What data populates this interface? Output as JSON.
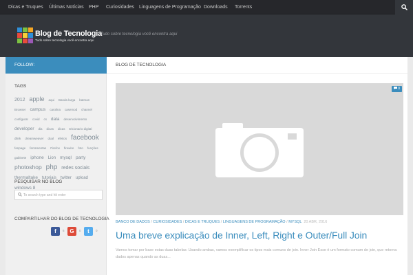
{
  "topnav": {
    "items": [
      "Dicas e Truques",
      "Últimas Notícias",
      "PHP",
      "Curiosidades",
      "Linguagens de Programação",
      "Downloads",
      "Torrents"
    ],
    "search_icon": "search-icon"
  },
  "header": {
    "brand_title": "Blog de Tecnologia",
    "brand_subtitle": "Tudo sobre tecnologia você encontra aqui",
    "tagline": "Tudo sobre tecnologia você encontra aqui"
  },
  "sidebar": {
    "follow_label": "FOLLOW:",
    "tags_title": "TAGS",
    "tags": [
      {
        "t": "2012",
        "s": 7
      },
      {
        "t": "apple",
        "s": 9
      },
      {
        "t": "aqui",
        "s": 4.5
      },
      {
        "t": "Banda larga",
        "s": 4.5
      },
      {
        "t": "batman",
        "s": 4.5
      },
      {
        "t": "Browser",
        "s": 4.5
      },
      {
        "t": "campus",
        "s": 6.5
      },
      {
        "t": "carolina",
        "s": 4.5
      },
      {
        "t": "casemod",
        "s": 4.5
      },
      {
        "t": "channel",
        "s": 4.5
      },
      {
        "t": "configurar",
        "s": 4.5
      },
      {
        "t": "covid",
        "s": 4.5
      },
      {
        "t": "cs",
        "s": 4.5
      },
      {
        "t": "data",
        "s": 6.5
      },
      {
        "t": "desenvolvimento",
        "s": 4.5
      },
      {
        "t": "developer",
        "s": 6.5
      },
      {
        "t": "dia",
        "s": 4.5
      },
      {
        "t": "dicas",
        "s": 4.5
      },
      {
        "t": "dicas",
        "s": 4.5
      },
      {
        "t": "Dicionario digital",
        "s": 4.5
      },
      {
        "t": "dlink",
        "s": 4.5
      },
      {
        "t": "dreamweaver",
        "s": 4.5
      },
      {
        "t": "dual",
        "s": 4.5
      },
      {
        "t": "efeitos",
        "s": 4.5
      },
      {
        "t": "facebook",
        "s": 10
      },
      {
        "t": "fanpage",
        "s": 4.5
      },
      {
        "t": "ferramentas",
        "s": 4.5
      },
      {
        "t": "Firefox",
        "s": 4.5
      },
      {
        "t": "firewire",
        "s": 4.5
      },
      {
        "t": "foto",
        "s": 4.5
      },
      {
        "t": "funções",
        "s": 4.5
      },
      {
        "t": "gabinete",
        "s": 4.5
      },
      {
        "t": "iphone",
        "s": 6.5
      },
      {
        "t": "Lion",
        "s": 6
      },
      {
        "t": "mysql",
        "s": 6.5
      },
      {
        "t": "party",
        "s": 6.5
      },
      {
        "t": "photoshop",
        "s": 8.5
      },
      {
        "t": "php",
        "s": 10
      },
      {
        "t": "redes sociais",
        "s": 7
      },
      {
        "t": "thermaltake",
        "s": 6.5
      },
      {
        "t": "tutoriais",
        "s": 6
      },
      {
        "t": "twitter",
        "s": 6
      },
      {
        "t": "upload",
        "s": 6
      },
      {
        "t": "windows 8",
        "s": 6.5
      }
    ],
    "search_title": "PESQUISAR NO BLOG",
    "search_placeholder": "To search type and hit enter",
    "share_title": "COMPARTILHAR DO BLOG DE TECNOLOGIA",
    "share": [
      {
        "name": "facebook",
        "glyph": "f",
        "count": "6",
        "color": "#3b5998"
      },
      {
        "name": "google-plus",
        "glyph": "G",
        "count": "0",
        "color": "#dd4b39"
      },
      {
        "name": "twitter",
        "glyph": "t",
        "count": "0",
        "color": "#55acee"
      }
    ]
  },
  "main": {
    "heading": "BLOG DE TECNOLOGIA",
    "post": {
      "comment_count": "0",
      "categories": [
        "BANCO DE DADOS",
        "CURIOSIDADES",
        "DICAS E TRUQUES",
        "LINGUAGENS DE PROGRAMAÇÃO",
        "MYSQL"
      ],
      "date": "20 ABR, 2016",
      "title": "Uma breve explicação de Inner, Left, Right e Outer/Full Join",
      "excerpt": "Vamos tomar por base estas duas tabelas: Usando ambas, vamos exemplificar os tipos mais comuns de join. Inner Join Esse é um formato comum de join, que retorna dados apenas quando as duas..."
    }
  },
  "colors": {
    "accent": "#3b8dbd",
    "header": "#33363b",
    "topnav": "#26272b"
  }
}
